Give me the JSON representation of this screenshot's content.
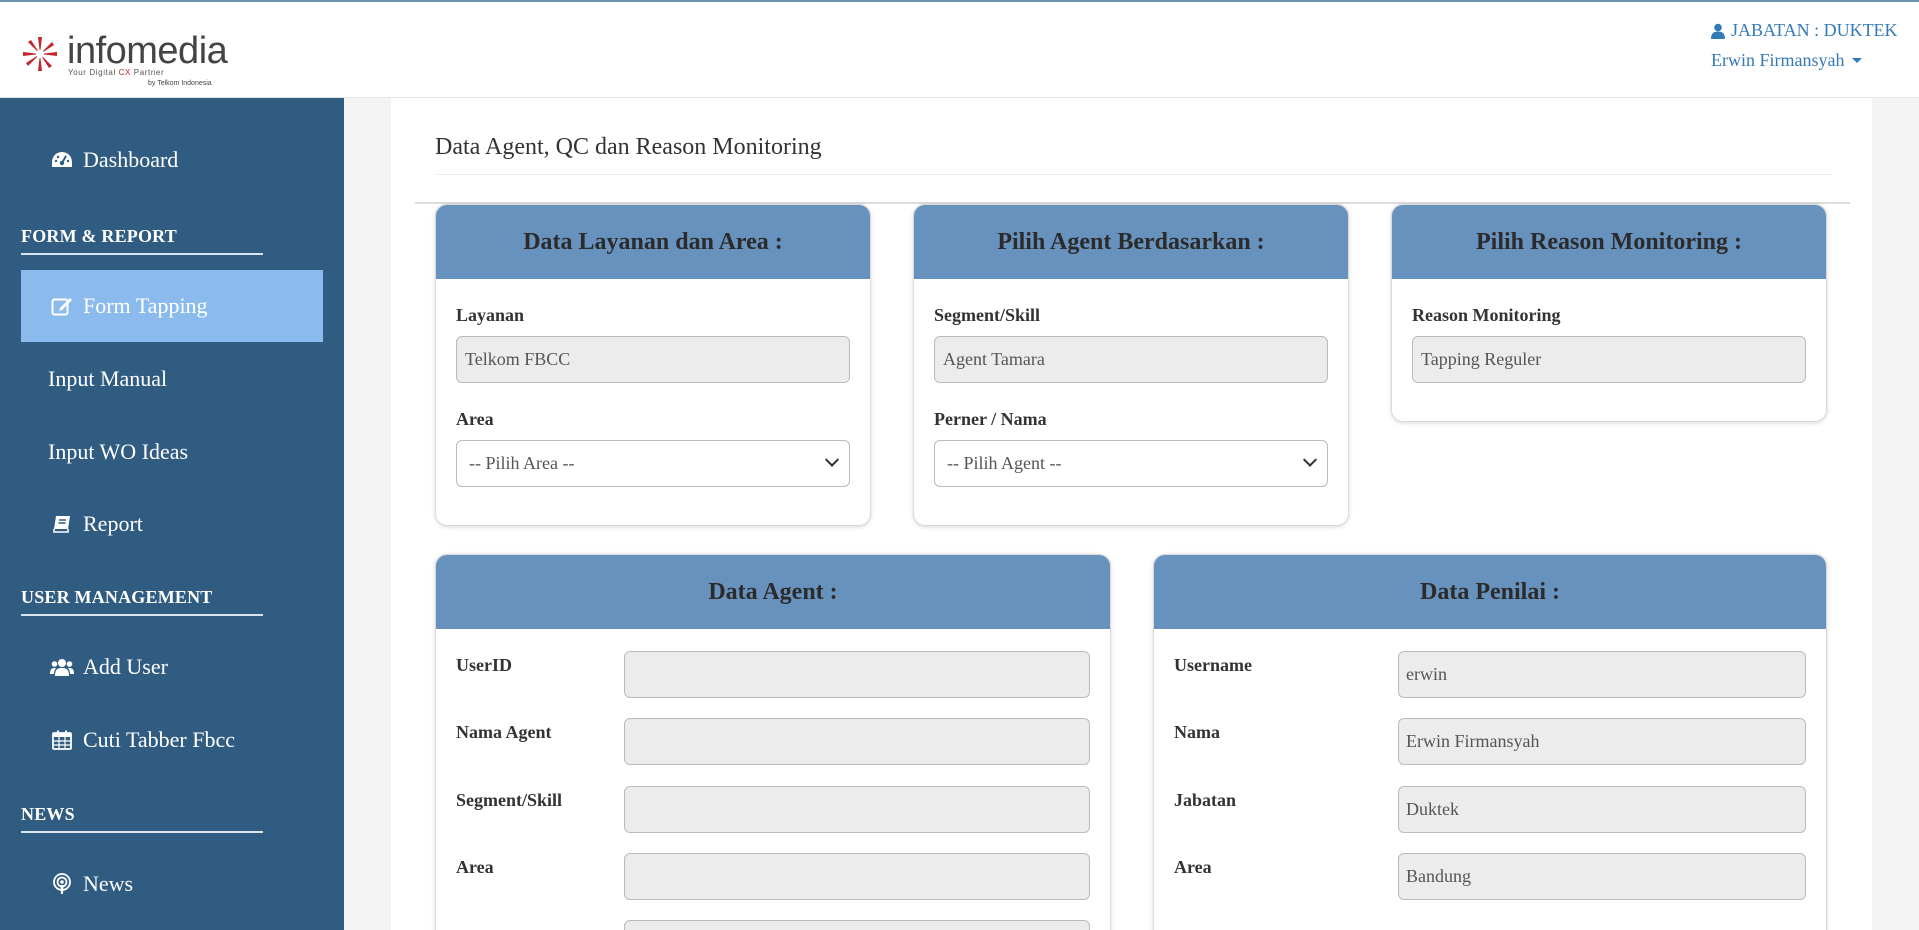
{
  "brand": {
    "name": "infomedia",
    "tagline_pre": "Your Digital ",
    "tagline_accent": "CX",
    "tagline_post": " Partner",
    "by": "by Telkom Indonesia"
  },
  "user": {
    "role": "JABATAN : DUKTEK",
    "name": "Erwin Firmansyah"
  },
  "sidebar": {
    "dashboard": "Dashboard",
    "section_form": "FORM & REPORT",
    "form_tapping": "Form Tapping",
    "input_manual": "Input Manual",
    "input_wo": "Input WO Ideas",
    "report": "Report",
    "section_user": "USER MANAGEMENT",
    "add_user": "Add User",
    "cuti": "Cuti Tabber Fbcc",
    "section_news": "NEWS",
    "news": "News"
  },
  "page": {
    "title": "Data Agent, QC dan Reason Monitoring"
  },
  "layanan_card": {
    "title": "Data Layanan dan Area :",
    "layanan_label": "Layanan",
    "layanan_value": "Telkom FBCC",
    "area_label": "Area",
    "area_selected": "-- Pilih Area --"
  },
  "agent_select_card": {
    "title": "Pilih Agent Berdasarkan :",
    "segment_label": "Segment/Skill",
    "segment_value": "Agent Tamara",
    "perner_label": "Perner / Nama",
    "perner_selected": "-- Pilih Agent --"
  },
  "reason_card": {
    "title": "Pilih Reason Monitoring :",
    "reason_label": "Reason Monitoring",
    "reason_value": "Tapping Reguler"
  },
  "data_agent": {
    "title": "Data Agent :",
    "userid_label": "UserID",
    "userid_value": "",
    "nama_label": "Nama Agent",
    "nama_value": "",
    "segment_label": "Segment/Skill",
    "segment_value": "",
    "area_label": "Area",
    "area_value": ""
  },
  "data_penilai": {
    "title": "Data Penilai :",
    "username_label": "Username",
    "username_value": "erwin",
    "nama_label": "Nama",
    "nama_value": "Erwin Firmansyah",
    "jabatan_label": "Jabatan",
    "jabatan_value": "Duktek",
    "area_label": "Area",
    "area_value": "Bandung"
  }
}
